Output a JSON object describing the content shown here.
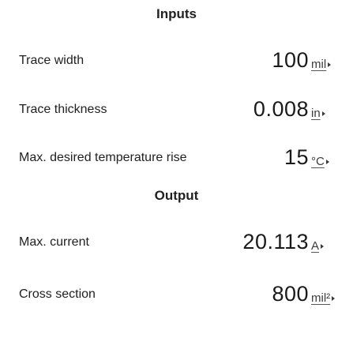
{
  "inputs": {
    "title": "Inputs",
    "rows": [
      {
        "label": "Trace width",
        "value": "100",
        "unit": "mil"
      },
      {
        "label": "Trace thickness",
        "value": "0.008",
        "unit": "in"
      },
      {
        "label": "Max. desired temperature rise",
        "value": "15",
        "unit": "°C"
      }
    ]
  },
  "output": {
    "title": "Output",
    "rows": [
      {
        "label": "Max. current",
        "value": "20.113",
        "unit": "A"
      },
      {
        "label": "Cross section",
        "value": "800",
        "unit": "mil²"
      }
    ]
  },
  "icons": {
    "unit_dropdown": "caret-right-icon"
  }
}
